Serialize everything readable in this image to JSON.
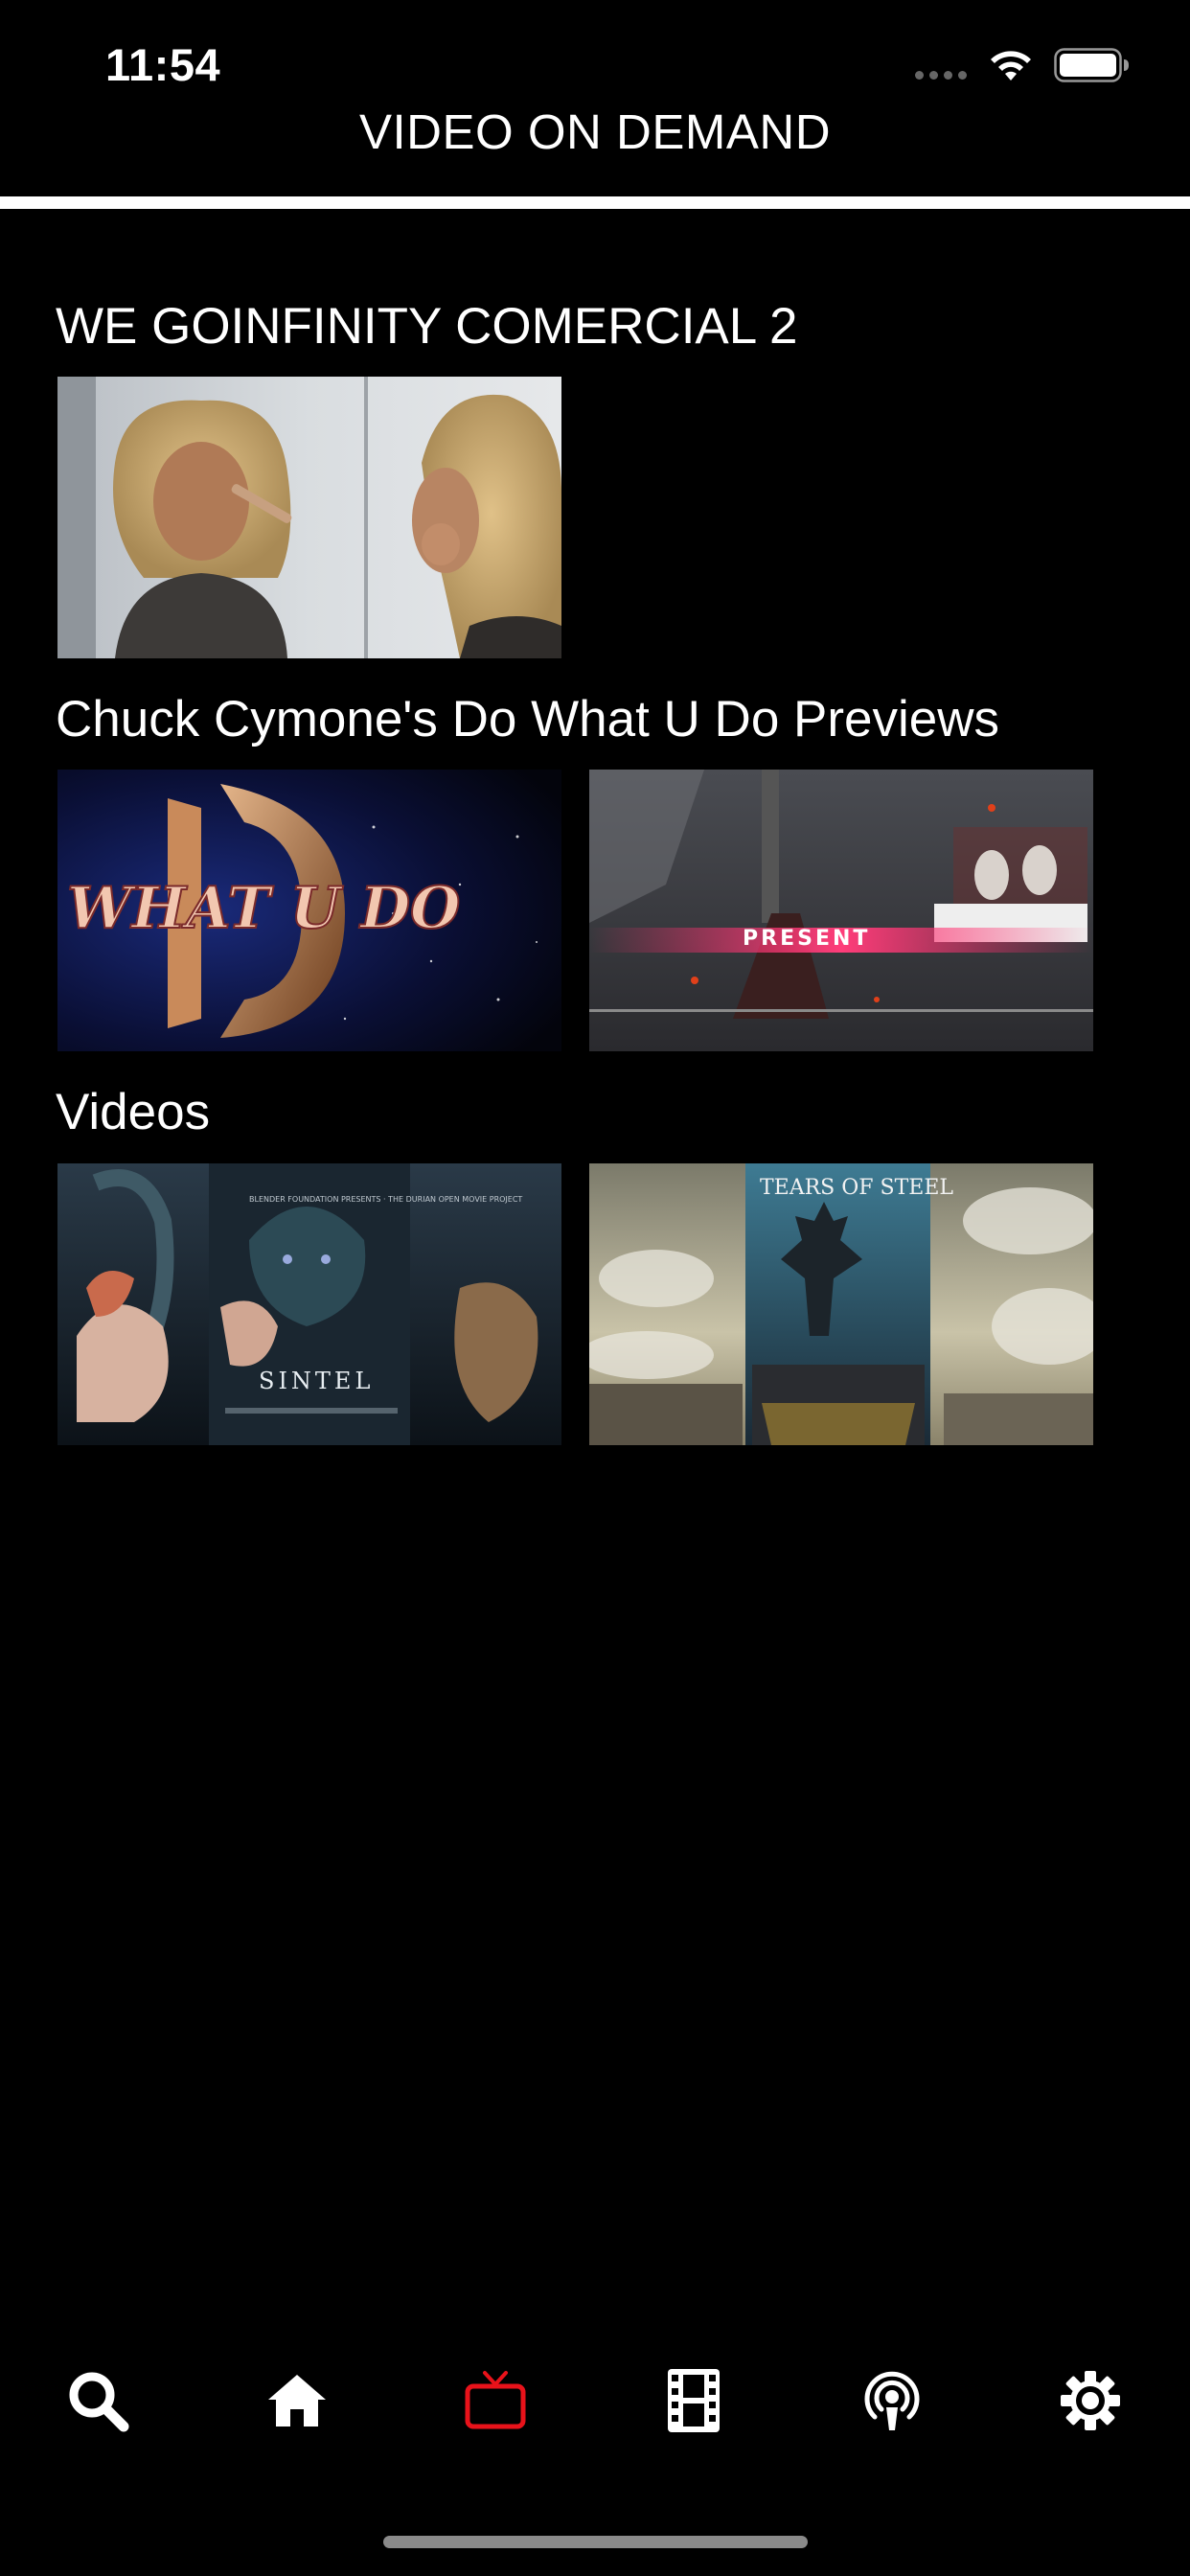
{
  "status_bar": {
    "time": "11:54"
  },
  "header": {
    "title": "VIDEO ON DEMAND"
  },
  "sections": [
    {
      "title": "WE GOINFINITY COMERCIAL 2",
      "items": [
        {
          "thumbnail": "woman-applying-makeup-mirror"
        }
      ]
    },
    {
      "title": "Chuck Cymone's Do What U Do Previews",
      "items": [
        {
          "thumbnail": "what-u-do-logo",
          "overlay_text": "WHAT U DO"
        },
        {
          "thumbnail": "stage-performance",
          "overlay_text": "PRESENT"
        }
      ]
    },
    {
      "title": "Videos",
      "items": [
        {
          "thumbnail": "sintel-poster",
          "overlay_text": "SINTEL",
          "top_text": "BLENDER FOUNDATION PRESENTS · THE DURIAN OPEN MOVIE PROJECT"
        },
        {
          "thumbnail": "tears-of-steel-poster",
          "overlay_text": "TEARS OF STEEL"
        }
      ]
    }
  ],
  "tab_bar": {
    "active_color": "#e8121a",
    "inactive_color": "#ffffff",
    "tabs": [
      {
        "icon": "search-icon",
        "active": false
      },
      {
        "icon": "home-icon",
        "active": false
      },
      {
        "icon": "tv-icon",
        "active": true
      },
      {
        "icon": "film-icon",
        "active": false
      },
      {
        "icon": "podcast-icon",
        "active": false
      },
      {
        "icon": "gear-icon",
        "active": false
      }
    ]
  }
}
